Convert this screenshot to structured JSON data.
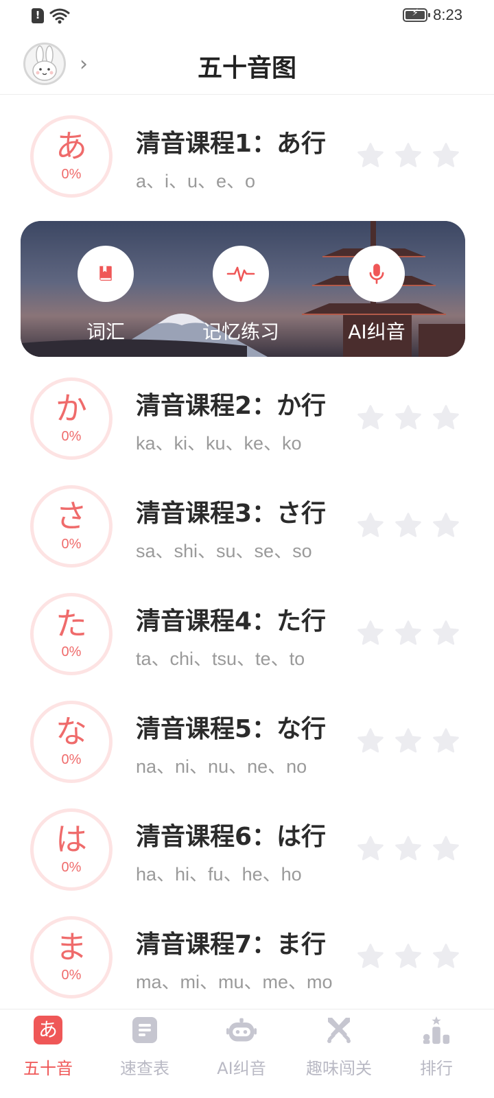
{
  "status_bar": {
    "time": "8:23"
  },
  "header": {
    "title": "五十音图"
  },
  "colors": {
    "accent": "#ef5757",
    "ring": "#fde3e3",
    "star": "#ececf0",
    "nav_inactive": "#b9b9c4"
  },
  "courses": [
    {
      "kana": "あ",
      "progress": "0%",
      "title": "清音课程1：あ行",
      "romaji": "a、i、u、e、o",
      "stars_filled": 0
    },
    {
      "kana": "か",
      "progress": "0%",
      "title": "清音课程2：か行",
      "romaji": "ka、ki、ku、ke、ko",
      "stars_filled": 0
    },
    {
      "kana": "さ",
      "progress": "0%",
      "title": "清音课程3：さ行",
      "romaji": "sa、shi、su、se、so",
      "stars_filled": 0
    },
    {
      "kana": "た",
      "progress": "0%",
      "title": "清音课程4：た行",
      "romaji": "ta、chi、tsu、te、to",
      "stars_filled": 0
    },
    {
      "kana": "な",
      "progress": "0%",
      "title": "清音课程5：な行",
      "romaji": "na、ni、nu、ne、no",
      "stars_filled": 0
    },
    {
      "kana": "は",
      "progress": "0%",
      "title": "清音课程6：は行",
      "romaji": "ha、hi、fu、he、ho",
      "stars_filled": 0
    },
    {
      "kana": "ま",
      "progress": "0%",
      "title": "清音课程7：ま行",
      "romaji": "ma、mi、mu、me、mo",
      "stars_filled": 0
    }
  ],
  "banner": {
    "items": [
      {
        "label": "词汇",
        "icon": "book-icon"
      },
      {
        "label": "记忆练习",
        "icon": "pulse-icon"
      },
      {
        "label": "AI纠音",
        "icon": "microphone-icon"
      }
    ]
  },
  "bottom_nav": {
    "items": [
      {
        "label": "五十音",
        "icon": "kana-tile-icon",
        "glyph": "あ",
        "active": true
      },
      {
        "label": "速查表",
        "icon": "document-icon",
        "active": false
      },
      {
        "label": "AI纠音",
        "icon": "robot-icon",
        "active": false
      },
      {
        "label": "趣味闯关",
        "icon": "crossed-swords-icon",
        "active": false
      },
      {
        "label": "排行",
        "icon": "podium-icon",
        "active": false
      }
    ]
  }
}
